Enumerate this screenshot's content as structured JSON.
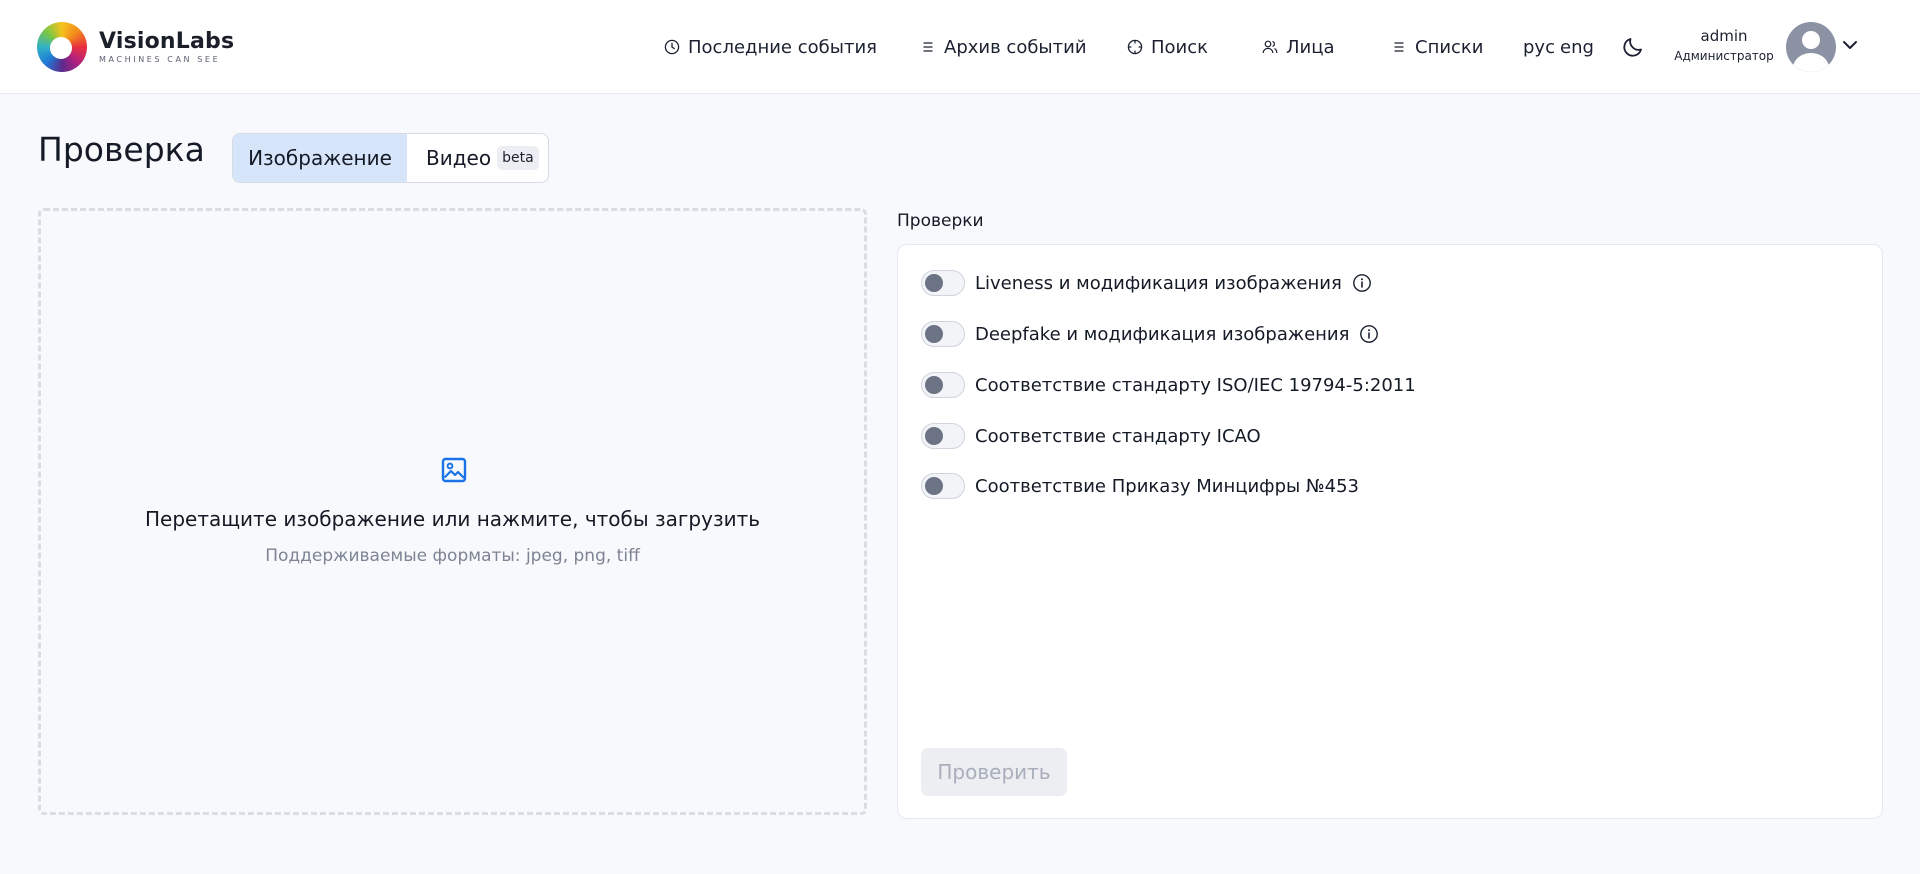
{
  "header": {
    "logo": {
      "name": "VisionLabs",
      "tagline": "MACHINES CAN SEE"
    },
    "nav": [
      {
        "label": "Последние события",
        "icon": "clock-icon"
      },
      {
        "label": "Архив событий",
        "icon": "list-icon"
      },
      {
        "label": "Поиск",
        "icon": "crosshair-icon"
      },
      {
        "label": "Лица",
        "icon": "users-icon"
      },
      {
        "label": "Списки",
        "icon": "list-icon"
      }
    ],
    "languages": [
      "рус",
      "eng"
    ],
    "theme_icon": "moon-icon",
    "user": {
      "name": "admin",
      "role": "Администратор",
      "avatar_icon": "user-avatar-icon",
      "menu_icon": "chevron-down-icon"
    }
  },
  "page": {
    "title": "Проверка",
    "tabs": [
      {
        "label": "Изображение",
        "active": true
      },
      {
        "label": "Видео",
        "badge": "beta",
        "active": false
      }
    ]
  },
  "upload": {
    "icon": "image-icon",
    "title": "Перетащите изображение или нажмите, чтобы загрузить",
    "formats": "Поддерживаемые форматы: jpeg, png, tiff"
  },
  "checks": {
    "label": "Проверки",
    "items": [
      {
        "label": "Liveness и модификация изображения",
        "enabled": false,
        "info": true
      },
      {
        "label": "Deepfake и модификация изображения",
        "enabled": false,
        "info": true
      },
      {
        "label": "Соответствие стандарту ISO/IEC 19794-5:2011",
        "enabled": false,
        "info": false
      },
      {
        "label": "Соответствие стандарту ICAO",
        "enabled": false,
        "info": false
      },
      {
        "label": "Соответствие Приказу Минцифры №453",
        "enabled": false,
        "info": false
      }
    ],
    "submit_label": "Проверить",
    "submit_disabled": true
  },
  "colors": {
    "accent": "#1a73e8",
    "active_tab_bg": "#d7e5fb",
    "toggle_knob": "#6b7384",
    "disabled_button_bg": "#eceef2"
  }
}
